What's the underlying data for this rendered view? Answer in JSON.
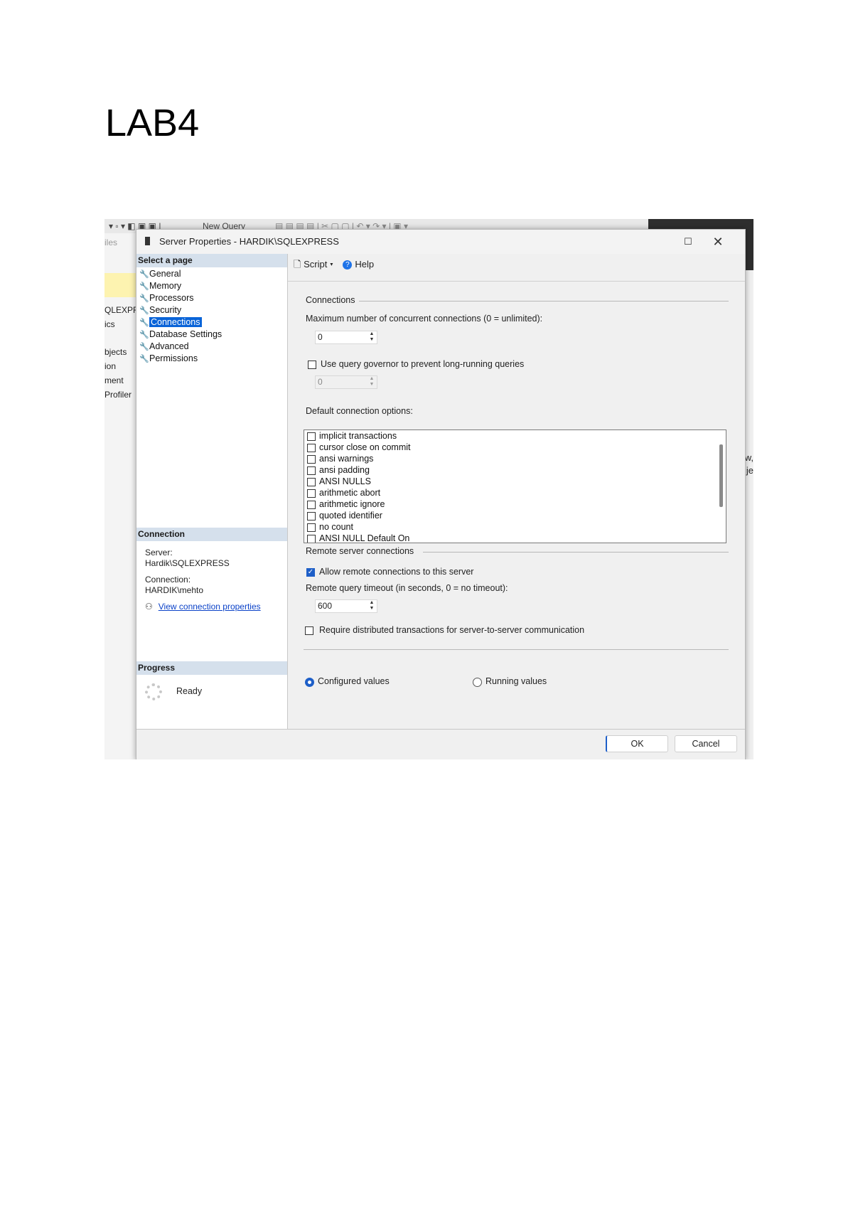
{
  "document": {
    "title": "LAB4"
  },
  "background_app": {
    "toolbar_new_query": "New Query",
    "left_fragments": [
      "iles",
      "QLEXPR",
      "ics",
      "bjects",
      "ion",
      "ment",
      "Profiler"
    ],
    "right_fragments": [
      "w,",
      "je"
    ]
  },
  "dialog": {
    "title": "Server Properties - HARDIK\\SQLEXPRESS",
    "maximize_glyph": "☐",
    "close_glyph": "✕",
    "select_page": {
      "header": "Select a page",
      "items": [
        "General",
        "Memory",
        "Processors",
        "Security",
        "Connections",
        "Database Settings",
        "Advanced",
        "Permissions"
      ],
      "selected": "Connections"
    },
    "connection": {
      "header": "Connection",
      "server_label": "Server:",
      "server_value": "Hardik\\SQLEXPRESS",
      "connection_label": "Connection:",
      "connection_value": "HARDIK\\mehto",
      "view_link": "View connection properties"
    },
    "progress": {
      "header": "Progress",
      "status": "Ready"
    },
    "toolbar": {
      "script": "Script",
      "help": "Help"
    },
    "connections": {
      "group_label": "Connections",
      "max_label": "Maximum number of concurrent connections (0 = unlimited):",
      "max_value": "0",
      "governor_label": "Use query governor to prevent long-running queries",
      "governor_checked": false,
      "governor_value": "0",
      "default_options_label": "Default connection options:",
      "options": [
        "implicit transactions",
        "cursor close on commit",
        "ansi warnings",
        "ansi padding",
        "ANSI NULLS",
        "arithmetic abort",
        "arithmetic ignore",
        "quoted identifier",
        "no count",
        "ANSI NULL Default On"
      ]
    },
    "remote": {
      "group_label": "Remote server connections",
      "allow_label": "Allow remote connections to this server",
      "allow_checked": true,
      "timeout_label": "Remote query timeout (in seconds, 0 = no timeout):",
      "timeout_value": "600",
      "distributed_label": "Require distributed transactions for server-to-server communication",
      "distributed_checked": false
    },
    "values_mode": {
      "configured": "Configured values",
      "running": "Running values",
      "selected": "Configured values"
    },
    "buttons": {
      "ok": "OK",
      "cancel": "Cancel"
    }
  }
}
